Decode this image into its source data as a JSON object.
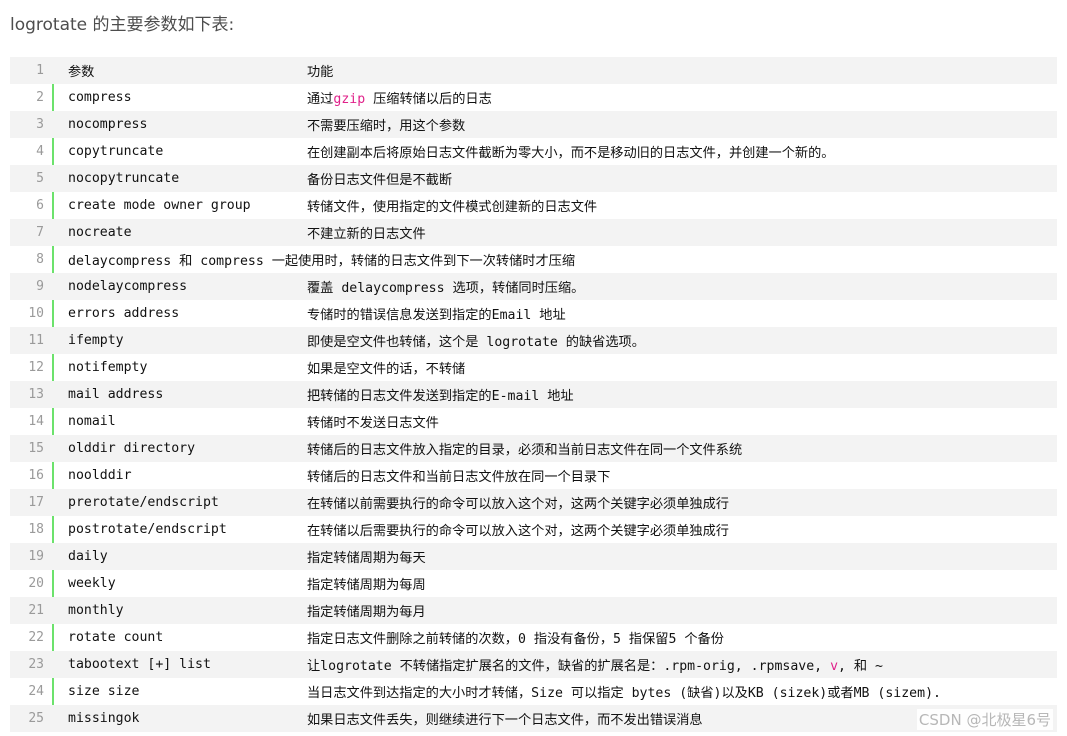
{
  "intro": "logrotate 的主要参数如下表:",
  "watermark": "CSDN @北极星6号",
  "rows": [
    {
      "n": "1",
      "k": "参数",
      "v": "功能"
    },
    {
      "n": "2",
      "k": "compress",
      "v_pre": "通过",
      "v_hl": "gzip",
      "v_post": " 压缩转储以后的日志"
    },
    {
      "n": "3",
      "k": "nocompress",
      "v": "不需要压缩时，用这个参数"
    },
    {
      "n": "4",
      "k": "copytruncate",
      "v": "在创建副本后将原始日志文件截断为零大小，而不是移动旧的日志文件，并创建一个新的。"
    },
    {
      "n": "5",
      "k": "nocopytruncate",
      "v": "备份日志文件但是不截断"
    },
    {
      "n": "6",
      "k": "create mode owner group",
      "v": "转储文件，使用指定的文件模式创建新的日志文件"
    },
    {
      "n": "7",
      "k": "nocreate",
      "v": "不建立新的日志文件"
    },
    {
      "n": "8",
      "full": "delaycompress 和 compress 一起使用时，转储的日志文件到下一次转储时才压缩"
    },
    {
      "n": "9",
      "k": "nodelaycompress",
      "v": "覆盖 delaycompress 选项，转储同时压缩。"
    },
    {
      "n": "10",
      "k": "errors address",
      "v": "专储时的错误信息发送到指定的Email 地址"
    },
    {
      "n": "11",
      "k": "ifempty",
      "v": "即使是空文件也转储，这个是 logrotate 的缺省选项。"
    },
    {
      "n": "12",
      "k": "notifempty",
      "v": "如果是空文件的话，不转储"
    },
    {
      "n": "13",
      "k": "mail address",
      "v": "把转储的日志文件发送到指定的E-mail 地址"
    },
    {
      "n": "14",
      "k": "nomail",
      "v": "转储时不发送日志文件"
    },
    {
      "n": "15",
      "k": "olddir directory",
      "v": "转储后的日志文件放入指定的目录，必须和当前日志文件在同一个文件系统"
    },
    {
      "n": "16",
      "k": "noolddir",
      "v": "转储后的日志文件和当前日志文件放在同一个目录下"
    },
    {
      "n": "17",
      "k": "prerotate/endscript",
      "v": "在转储以前需要执行的命令可以放入这个对，这两个关键字必须单独成行"
    },
    {
      "n": "18",
      "k": "postrotate/endscript",
      "v": "在转储以后需要执行的命令可以放入这个对，这两个关键字必须单独成行"
    },
    {
      "n": "19",
      "k": "daily",
      "v": "指定转储周期为每天"
    },
    {
      "n": "20",
      "k": "weekly",
      "v": "指定转储周期为每周"
    },
    {
      "n": "21",
      "k": "monthly",
      "v": "指定转储周期为每月"
    },
    {
      "n": "22",
      "k": "rotate count",
      "v": "指定日志文件删除之前转储的次数，0 指没有备份，5 指保留5 个备份"
    },
    {
      "n": "23",
      "k": "tabootext [+] list",
      "v_pre": "让logrotate 不转储指定扩展名的文件，缺省的扩展名是：.rpm-orig, .rpmsave, ",
      "v_hl": "v",
      "v_post": ", 和 ~"
    },
    {
      "n": "24",
      "k": "size size",
      "v": "当日志文件到达指定的大小时才转储，Size 可以指定 bytes (缺省)以及KB (sizek)或者MB (sizem)."
    },
    {
      "n": "25",
      "k": "missingok",
      "v": "如果日志文件丢失，则继续进行下一个日志文件，而不发出错误消息"
    }
  ]
}
